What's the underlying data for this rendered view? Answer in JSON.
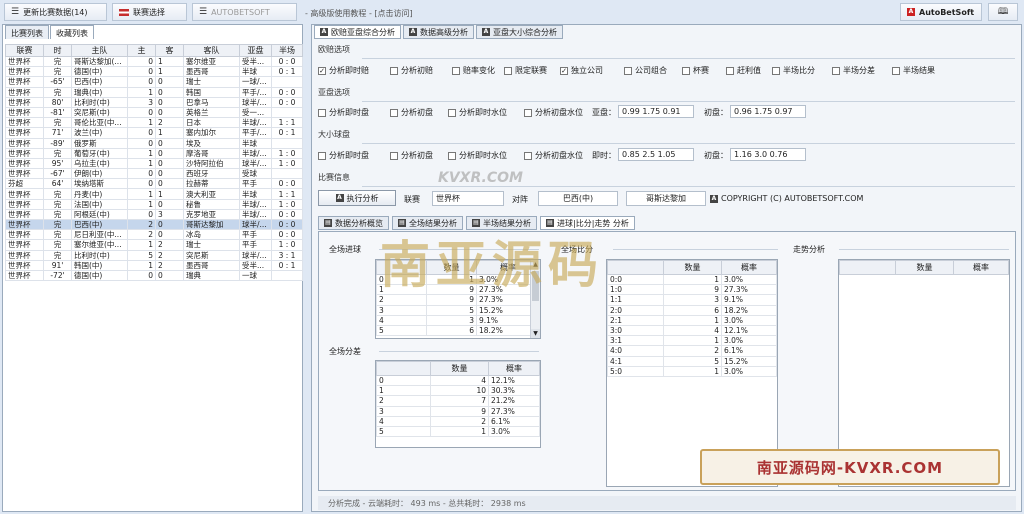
{
  "toolbar": {
    "update_label": "更新比赛数据(14)",
    "league_label": "联赛选择",
    "autobetsoft_label": "AUTOBETSOFT",
    "info_text": "- 高级版使用教程 - [点击访问]",
    "brand_label": "AutoBetSoft"
  },
  "left": {
    "tabs": [
      "比赛列表",
      "收藏列表"
    ],
    "headers": [
      "联赛",
      "时",
      "主队",
      "主",
      "客",
      "客队",
      "亚盘",
      "半场"
    ],
    "rows": [
      [
        "世界杯",
        "完",
        "哥斯达黎加(...",
        "0",
        "1",
        "塞尔维亚",
        "受半...",
        "0 : 0"
      ],
      [
        "世界杯",
        "完",
        "德国(中)",
        "0",
        "1",
        "墨西哥",
        "半球",
        "0 : 1"
      ],
      [
        "世界杯",
        "-65'",
        "巴西(中)",
        "0",
        "0",
        "瑞士",
        "一球/...",
        ""
      ],
      [
        "世界杯",
        "完",
        "瑞典(中)",
        "1",
        "0",
        "韩国",
        "平手/...",
        "0 : 0"
      ],
      [
        "世界杯",
        "80'",
        "比利时(中)",
        "3",
        "0",
        "巴拿马",
        "球半/...",
        "0 : 0"
      ],
      [
        "世界杯",
        "-81'",
        "突尼斯(中)",
        "0",
        "0",
        "英格兰",
        "受一...",
        ""
      ],
      [
        "世界杯",
        "完",
        "哥伦比亚(中...",
        "1",
        "2",
        "日本",
        "半球/...",
        "1 : 1"
      ],
      [
        "世界杯",
        "71'",
        "波兰(中)",
        "0",
        "1",
        "塞内加尔",
        "平手/...",
        "0 : 1"
      ],
      [
        "世界杯",
        "-89'",
        "俄罗斯",
        "0",
        "0",
        "埃及",
        "半球",
        ""
      ],
      [
        "世界杯",
        "完",
        "葡萄牙(中)",
        "1",
        "0",
        "摩洛哥",
        "半球/...",
        "1 : 0"
      ],
      [
        "世界杯",
        "95'",
        "乌拉圭(中)",
        "1",
        "0",
        "沙特阿拉伯",
        "球半/...",
        "1 : 0"
      ],
      [
        "世界杯",
        "-67'",
        "伊朗(中)",
        "0",
        "0",
        "西班牙",
        "受球",
        ""
      ],
      [
        "芬超",
        "64'",
        "埃纳塔斯",
        "0",
        "0",
        "拉赫蒂",
        "平手",
        "0 : 0"
      ],
      [
        "世界杯",
        "完",
        "丹麦(中)",
        "1",
        "1",
        "澳大利亚",
        "半球",
        "1 : 1"
      ],
      [
        "世界杯",
        "完",
        "法国(中)",
        "1",
        "0",
        "秘鲁",
        "半球/...",
        "1 : 0"
      ],
      [
        "世界杯",
        "完",
        "阿根廷(中)",
        "0",
        "3",
        "克罗地亚",
        "半球/...",
        "0 : 0"
      ],
      [
        "世界杯",
        "完",
        "巴西(中)",
        "2",
        "0",
        "哥斯达黎加",
        "球半/...",
        "0 : 0"
      ],
      [
        "世界杯",
        "完",
        "尼日利亚(中...",
        "2",
        "0",
        "冰岛",
        "平手",
        "0 : 0"
      ],
      [
        "世界杯",
        "完",
        "塞尔维亚(中...",
        "1",
        "2",
        "瑞士",
        "平手",
        "1 : 0"
      ],
      [
        "世界杯",
        "完",
        "比利时(中)",
        "5",
        "2",
        "突尼斯",
        "球半/...",
        "3 : 1"
      ],
      [
        "世界杯",
        "91'",
        "韩国(中)",
        "1",
        "2",
        "墨西哥",
        "受半...",
        "0 : 1"
      ],
      [
        "世界杯",
        "-72'",
        "德国(中)",
        "0",
        "0",
        "瑞典",
        "一球",
        ""
      ]
    ],
    "selected_index": 16
  },
  "right": {
    "tabs": [
      "欧赔亚盘综合分析",
      "数据高级分析",
      "亚盘大小综合分析"
    ],
    "euro": {
      "title": "欧赔选项",
      "options": [
        {
          "label": "分析即时赔",
          "checked": true
        },
        {
          "label": "分析初赔",
          "checked": false
        },
        {
          "label": "赔率变化",
          "checked": false
        },
        {
          "label": "限定联赛",
          "checked": false
        },
        {
          "label": "独立公司",
          "checked": true
        },
        {
          "label": "公司组合",
          "checked": false
        },
        {
          "label": "杯赛",
          "checked": false
        },
        {
          "label": "赶利值",
          "checked": false
        },
        {
          "label": "半场比分",
          "checked": false
        },
        {
          "label": "半场分差",
          "checked": false
        },
        {
          "label": "半场结果",
          "checked": false
        }
      ]
    },
    "asia": {
      "title": "亚盘选项",
      "options": [
        "分析即时盘",
        "分析初盘",
        "分析即时水位",
        "分析初盘水位"
      ],
      "now_label": "亚盘：",
      "now_value": "0.99  1.75  0.91",
      "init_label": "初盘：",
      "init_value": "0.96  1.75  0.97"
    },
    "ou": {
      "title": "大小球盘",
      "options": [
        "分析即时盘",
        "分析初盘",
        "分析即时水位",
        "分析初盘水位"
      ],
      "now_label": "即时：",
      "now_value": "0.85  2.5  1.05",
      "init_label": "初盘：",
      "init_value": "1.16  3.0  0.76"
    },
    "match": {
      "title": "比赛信息",
      "exec_label": "执行分析",
      "league_label": "联赛",
      "league_value": "世界杯",
      "vs_label": "对阵",
      "home": "巴西(中)",
      "away": "哥斯达黎加",
      "copyright": "COPYRIGHT (C) AUTOBETSOFT.COM"
    },
    "subtabs": [
      "数据分析概览",
      "全场结果分析",
      "半场结果分析",
      "进球|比分|走势 分析"
    ],
    "goals": {
      "title": "全场进球",
      "headers": [
        "",
        "数量",
        "概率"
      ],
      "rows": [
        [
          "0",
          "1",
          "3.0%"
        ],
        [
          "1",
          "9",
          "27.3%"
        ],
        [
          "2",
          "9",
          "27.3%"
        ],
        [
          "3",
          "5",
          "15.2%"
        ],
        [
          "4",
          "3",
          "9.1%"
        ],
        [
          "5",
          "6",
          "18.2%"
        ]
      ]
    },
    "diff": {
      "title": "全场分差",
      "headers": [
        "",
        "数量",
        "概率"
      ],
      "rows": [
        [
          "0",
          "4",
          "12.1%"
        ],
        [
          "1",
          "10",
          "30.3%"
        ],
        [
          "2",
          "7",
          "21.2%"
        ],
        [
          "3",
          "9",
          "27.3%"
        ],
        [
          "4",
          "2",
          "6.1%"
        ],
        [
          "5",
          "1",
          "3.0%"
        ]
      ]
    },
    "score": {
      "title": "全场比分",
      "headers": [
        "",
        "数量",
        "概率"
      ],
      "rows": [
        [
          "0:0",
          "1",
          "3.0%"
        ],
        [
          "1:0",
          "9",
          "27.3%"
        ],
        [
          "1:1",
          "3",
          "9.1%"
        ],
        [
          "2:0",
          "6",
          "18.2%"
        ],
        [
          "2:1",
          "1",
          "3.0%"
        ],
        [
          "3:0",
          "4",
          "12.1%"
        ],
        [
          "3:1",
          "1",
          "3.0%"
        ],
        [
          "4:0",
          "2",
          "6.1%"
        ],
        [
          "4:1",
          "5",
          "15.2%"
        ],
        [
          "5:0",
          "1",
          "3.0%"
        ]
      ]
    },
    "trend": {
      "title": "走势分析",
      "headers": [
        "",
        "数量",
        "概率"
      ]
    },
    "status": "分析完成 - 云端耗时：  493 ms - 总共耗时：  2938 ms"
  },
  "watermarks": {
    "main": "南亚源码",
    "url1": "KVXR.COM",
    "url2": "南亚源码网-KVXR.COM"
  }
}
